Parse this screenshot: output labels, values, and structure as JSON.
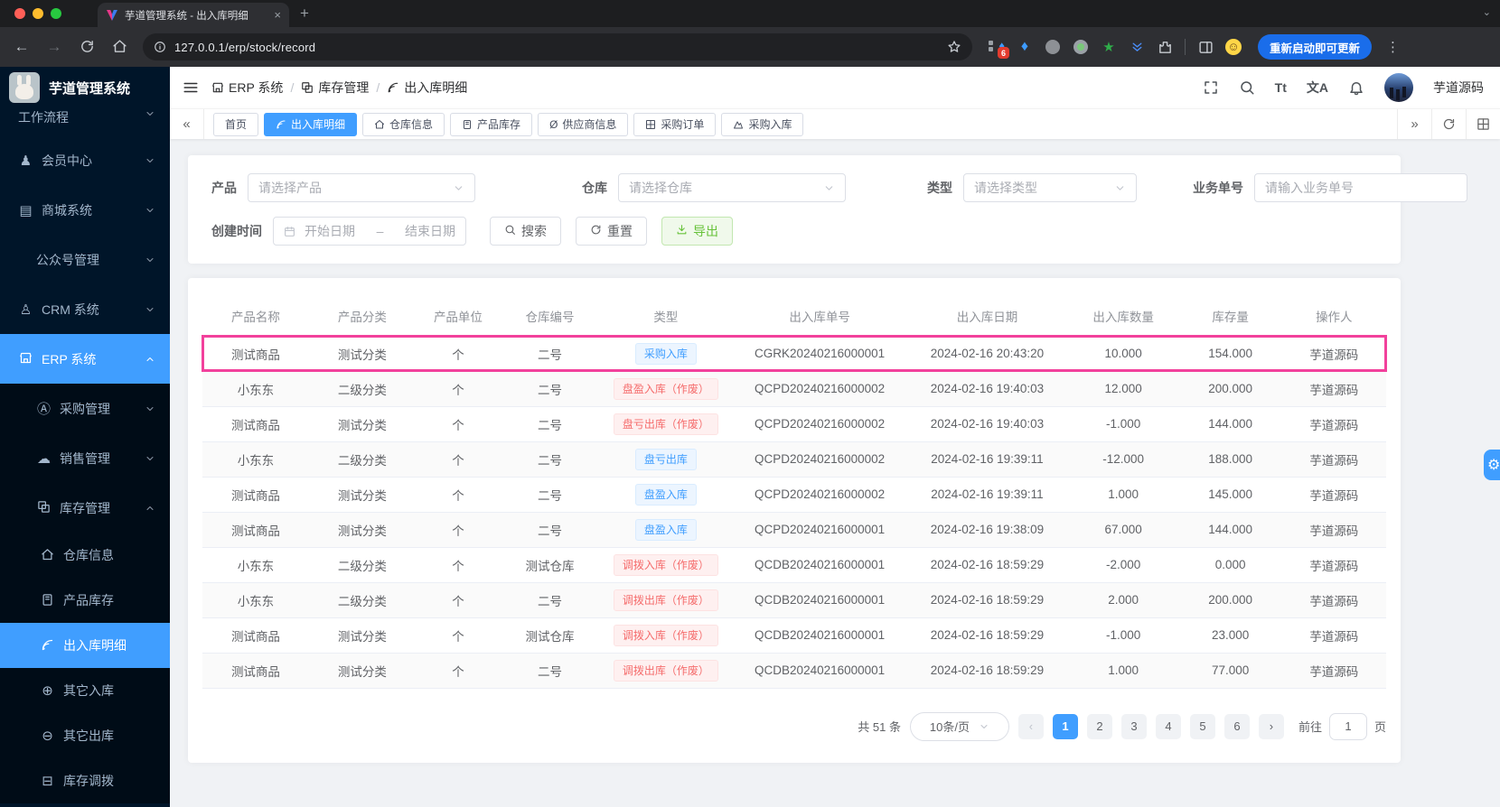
{
  "browser": {
    "tab_title": "芋道管理系统 - 出入库明细",
    "url": "127.0.0.1/erp/stock/record",
    "update_button_label": "重新启动即可更新",
    "extension_badge": "6"
  },
  "sidebar": {
    "app_title": "芋道管理系统",
    "items": [
      {
        "key": "workflow",
        "label": "工作流程",
        "icon": "",
        "level": 0,
        "chevron": "down",
        "cut_top": true
      },
      {
        "key": "member-center",
        "label": "会员中心",
        "icon": "member",
        "level": 0,
        "chevron": "down"
      },
      {
        "key": "mall-system",
        "label": "商城系统",
        "icon": "mall",
        "level": 0,
        "chevron": "down"
      },
      {
        "key": "official-account",
        "label": "公众号管理",
        "icon": "",
        "level": 1,
        "chevron": "down"
      },
      {
        "key": "crm-system",
        "label": "CRM 系统",
        "icon": "crm",
        "level": 0,
        "chevron": "down"
      },
      {
        "key": "erp-system",
        "label": "ERP 系统",
        "icon": "store",
        "level": 0,
        "chevron": "up",
        "active": true
      },
      {
        "key": "purchase-mgmt",
        "label": "采购管理",
        "icon": "purchase",
        "level": 1,
        "chevron": "down",
        "dark": true
      },
      {
        "key": "sales-mgmt",
        "label": "销售管理",
        "icon": "sales",
        "level": 1,
        "chevron": "down",
        "dark": true
      },
      {
        "key": "stock-mgmt",
        "label": "库存管理",
        "icon": "stock",
        "level": 1,
        "chevron": "up",
        "dark": true
      },
      {
        "key": "warehouse-info",
        "label": "仓库信息",
        "icon": "home",
        "level": 2,
        "dark": true
      },
      {
        "key": "product-stock",
        "label": "产品库存",
        "icon": "product",
        "level": 2,
        "dark": true
      },
      {
        "key": "stock-record",
        "label": "出入库明细",
        "icon": "record",
        "level": 2,
        "dark": true,
        "active": true
      },
      {
        "key": "other-in",
        "label": "其它入库",
        "icon": "other-in",
        "level": 2,
        "dark": true
      },
      {
        "key": "other-out",
        "label": "其它出库",
        "icon": "other-out",
        "level": 2,
        "dark": true
      },
      {
        "key": "stock-transfer",
        "label": "库存调拨",
        "icon": "transfer",
        "level": 2,
        "dark": true,
        "cut_bottom": true
      }
    ]
  },
  "header": {
    "breadcrumb": [
      {
        "key": "erp-system",
        "label": "ERP 系统",
        "icon": "store"
      },
      {
        "key": "stock-mgmt",
        "label": "库存管理",
        "icon": "stock"
      },
      {
        "key": "stock-record",
        "label": "出入库明细",
        "icon": "record"
      }
    ],
    "username": "芋道源码"
  },
  "tags_bar": {
    "tabs": [
      {
        "key": "home",
        "label": "首页"
      },
      {
        "key": "stock-record",
        "label": "出入库明细",
        "icon": "record",
        "active": true
      },
      {
        "key": "warehouse-info",
        "label": "仓库信息",
        "icon": "home"
      },
      {
        "key": "product-stock",
        "label": "产品库存",
        "icon": "product"
      },
      {
        "key": "supplier-info",
        "label": "供应商信息",
        "icon": "supplier"
      },
      {
        "key": "purchase-order",
        "label": "采购订单",
        "icon": "order"
      },
      {
        "key": "purchase-in",
        "label": "采购入库",
        "icon": "mountain"
      }
    ]
  },
  "filters": {
    "product_label": "产品",
    "product_placeholder": "请选择产品",
    "warehouse_label": "仓库",
    "warehouse_placeholder": "请选择仓库",
    "type_label": "类型",
    "type_placeholder": "请选择类型",
    "bizno_label": "业务单号",
    "bizno_placeholder": "请输入业务单号",
    "time_label": "创建时间",
    "time_start_placeholder": "开始日期",
    "time_separator": "–",
    "time_end_placeholder": "结束日期",
    "search_label": "搜索",
    "reset_label": "重置",
    "export_label": "导出"
  },
  "table": {
    "columns": [
      "产品名称",
      "产品分类",
      "产品单位",
      "仓库编号",
      "类型",
      "出入库单号",
      "出入库日期",
      "出入库数量",
      "库存量",
      "操作人"
    ],
    "rows": [
      {
        "name": "测试商品",
        "category": "测试分类",
        "unit": "个",
        "warehouse": "二号",
        "tag": "采购入库",
        "tag_color": "blue",
        "order_no": "CGRK20240216000001",
        "datetime": "2024-02-16 20:43:20",
        "quantity": "10.000",
        "stock": "154.000",
        "operator": "芋道源码",
        "highlighted": true
      },
      {
        "name": "小东东",
        "category": "二级分类",
        "unit": "个",
        "warehouse": "二号",
        "tag": "盘盈入库（作废）",
        "tag_color": "red",
        "order_no": "QCPD20240216000002",
        "datetime": "2024-02-16 19:40:03",
        "quantity": "12.000",
        "stock": "200.000",
        "operator": "芋道源码"
      },
      {
        "name": "测试商品",
        "category": "测试分类",
        "unit": "个",
        "warehouse": "二号",
        "tag": "盘亏出库（作废）",
        "tag_color": "red",
        "order_no": "QCPD20240216000002",
        "datetime": "2024-02-16 19:40:03",
        "quantity": "-1.000",
        "stock": "144.000",
        "operator": "芋道源码"
      },
      {
        "name": "小东东",
        "category": "二级分类",
        "unit": "个",
        "warehouse": "二号",
        "tag": "盘亏出库",
        "tag_color": "blue",
        "order_no": "QCPD20240216000002",
        "datetime": "2024-02-16 19:39:11",
        "quantity": "-12.000",
        "stock": "188.000",
        "operator": "芋道源码"
      },
      {
        "name": "测试商品",
        "category": "测试分类",
        "unit": "个",
        "warehouse": "二号",
        "tag": "盘盈入库",
        "tag_color": "blue",
        "order_no": "QCPD20240216000002",
        "datetime": "2024-02-16 19:39:11",
        "quantity": "1.000",
        "stock": "145.000",
        "operator": "芋道源码"
      },
      {
        "name": "测试商品",
        "category": "测试分类",
        "unit": "个",
        "warehouse": "二号",
        "tag": "盘盈入库",
        "tag_color": "blue",
        "order_no": "QCPD20240216000001",
        "datetime": "2024-02-16 19:38:09",
        "quantity": "67.000",
        "stock": "144.000",
        "operator": "芋道源码"
      },
      {
        "name": "小东东",
        "category": "二级分类",
        "unit": "个",
        "warehouse": "测试仓库",
        "tag": "调拨入库（作废）",
        "tag_color": "red",
        "order_no": "QCDB20240216000001",
        "datetime": "2024-02-16 18:59:29",
        "quantity": "-2.000",
        "stock": "0.000",
        "operator": "芋道源码"
      },
      {
        "name": "小东东",
        "category": "二级分类",
        "unit": "个",
        "warehouse": "二号",
        "tag": "调拨出库（作废）",
        "tag_color": "red",
        "order_no": "QCDB20240216000001",
        "datetime": "2024-02-16 18:59:29",
        "quantity": "2.000",
        "stock": "200.000",
        "operator": "芋道源码"
      },
      {
        "name": "测试商品",
        "category": "测试分类",
        "unit": "个",
        "warehouse": "测试仓库",
        "tag": "调拨入库（作废）",
        "tag_color": "red",
        "order_no": "QCDB20240216000001",
        "datetime": "2024-02-16 18:59:29",
        "quantity": "-1.000",
        "stock": "23.000",
        "operator": "芋道源码"
      },
      {
        "name": "测试商品",
        "category": "测试分类",
        "unit": "个",
        "warehouse": "二号",
        "tag": "调拨出库（作废）",
        "tag_color": "red",
        "order_no": "QCDB20240216000001",
        "datetime": "2024-02-16 18:59:29",
        "quantity": "1.000",
        "stock": "77.000",
        "operator": "芋道源码"
      }
    ]
  },
  "pagination": {
    "total": "共 51 条",
    "page_size": "10条/页",
    "pages": [
      "1",
      "2",
      "3",
      "4",
      "5",
      "6"
    ],
    "active_page": "1",
    "goto_label": "前往",
    "goto_value": "1",
    "page_unit": "页"
  },
  "colors": {
    "primary": "#409eff",
    "highlight_row_border": "#f2419c",
    "tag_blue": "#409eff",
    "tag_red": "#f56c6c",
    "export_green": "#67c23a"
  }
}
